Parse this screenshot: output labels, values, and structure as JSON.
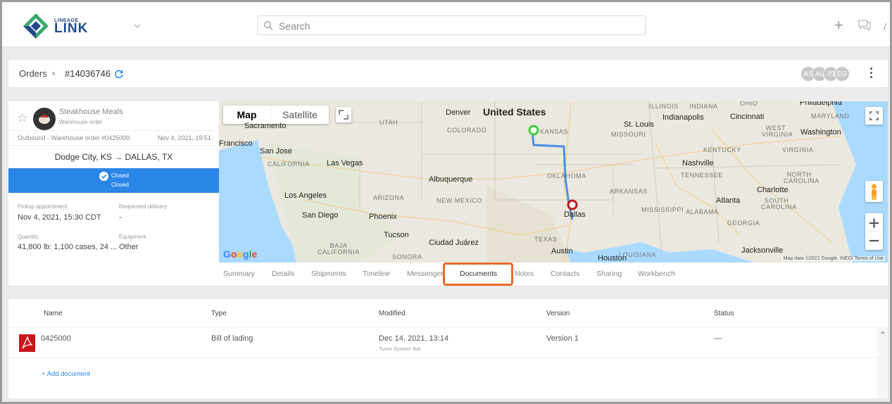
{
  "header": {
    "logo_small": "LINEAGE",
    "logo_big": "LINK",
    "search_placeholder": "Search"
  },
  "breadcrumb": {
    "orders": "Orders",
    "separator": "›",
    "order_id": "#14036746"
  },
  "collaborators": [
    "AS",
    "AL",
    "JS",
    "EG"
  ],
  "order_card": {
    "customer": "Steakhouse Meals",
    "customer_type": "Warehouse order",
    "order_line": "Outbound - Warehouse order #0425000",
    "order_date": "Nov 4, 2021, 19:51",
    "route": "Dodge City, KS → DALLAS, TX",
    "status_1": "Closed",
    "status_2": "Closed",
    "status_color": "#2a86e6",
    "pickup_label": "Pickup appointment",
    "pickup_value": "Nov 4, 2021, 15:30 CDT",
    "delivery_label": "Requested delivery",
    "delivery_value": "-",
    "quantity_label": "Quantity",
    "quantity_value": "41,800 lb: 1,100 cases, 24 ...",
    "equipment_label": "Equipment",
    "equipment_value": "Other"
  },
  "map": {
    "tab_map": "Map",
    "tab_satellite": "Satellite",
    "country": "United States",
    "attribution": "Map data ©2022 Google, INEGI   Terms of Use",
    "google": "Google",
    "cities": {
      "denver": "Denver",
      "st_louis": "St. Louis",
      "indianapolis": "Indianapolis",
      "cincinnati": "Cincinnati",
      "washington": "Washington",
      "philadelphia": "Philadelphia",
      "sacramento": "Sacramento",
      "san_francisco": "Francisco",
      "san_jose": "San Jose",
      "las_vegas": "Las Vegas",
      "albuquerque": "Albuquerque",
      "nashville": "Nashville",
      "charlotte": "Charlotte",
      "los_angeles": "Los Angeles",
      "san_diego": "San Diego",
      "phoenix": "Phoenix",
      "tucson": "Tucson",
      "ciudad_juarez": "Ciudad Juárez",
      "dallas": "Dallas",
      "atlanta": "Atlanta",
      "austin": "Austin",
      "houston": "Houston",
      "jacksonville": "Jacksonville"
    },
    "states": {
      "utah": "UTAH",
      "colorado": "COLORADO",
      "kansas": "KANSAS",
      "missouri": "MISSOURI",
      "california": "CALIFORNIA",
      "oklahoma": "OKLAHOMA",
      "arizona": "ARIZONA",
      "new_mexico": "NEW MEXICO",
      "arkansas": "ARKANSAS",
      "texas": "TEXAS",
      "tennessee": "TENNESSEE",
      "mississippi": "MISSISSIPPI",
      "alabama": "ALABAMA",
      "georgia": "GEORGIA",
      "louisiana": "LOUISIANA",
      "kentucky": "KENTUCKY",
      "virginia": "VIRGINIA",
      "west_virginia": "WEST\nVIRGINIA",
      "north_carolina": "NORTH\nCAROLINA",
      "south_carolina": "SOUTH\nCAROLINA",
      "illinois": "ILLINOIS",
      "indiana": "INDIANA",
      "ohio": "OHIO",
      "maryland": "MARYLAND",
      "baja": "BAJA\nCALIFORNIA",
      "sonora": "SONORA"
    }
  },
  "tabs": [
    "Summary",
    "Details",
    "Shipments",
    "Timeline",
    "Messenger",
    "Documents",
    "Notes",
    "Contacts",
    "Sharing",
    "Workbench"
  ],
  "active_tab": "Documents",
  "documents": {
    "columns": [
      "Name",
      "Type",
      "Modified",
      "Version",
      "Status"
    ],
    "rows": [
      {
        "name": "0425000",
        "type": "Bill of lading",
        "modified": "Dec 14, 2021, 13:14",
        "modified_by": "Turvo System Bot",
        "version": "Version 1",
        "status": "—"
      }
    ],
    "add_label": "+ Add document"
  }
}
